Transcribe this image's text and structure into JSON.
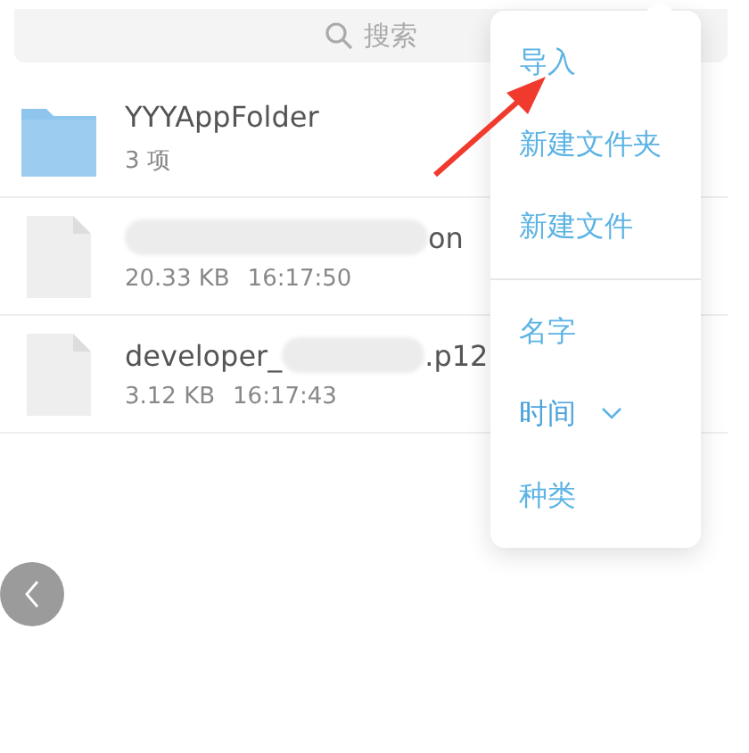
{
  "search": {
    "placeholder": "搜索"
  },
  "files": [
    {
      "kind": "folder",
      "name": [
        {
          "kind": "text",
          "text": "YYYAppFolder"
        }
      ],
      "detail": [
        "3 项"
      ]
    },
    {
      "kind": "file",
      "name": [
        {
          "kind": "redacted"
        },
        {
          "kind": "text",
          "text": "on"
        }
      ],
      "detail": [
        "20.33 KB",
        "16:17:50"
      ]
    },
    {
      "kind": "file",
      "name": [
        {
          "kind": "text",
          "text": "developer_"
        },
        {
          "kind": "redacted"
        },
        {
          "kind": "text",
          "text": ".p12"
        }
      ],
      "detail": [
        "3.12 KB",
        "16:17:43"
      ]
    }
  ],
  "menu": {
    "actions": [
      "导入",
      "新建文件夹",
      "新建文件"
    ],
    "sort": [
      {
        "label": "名字",
        "selected": false
      },
      {
        "label": "时间",
        "selected": true
      },
      {
        "label": "种类",
        "selected": false
      }
    ]
  }
}
